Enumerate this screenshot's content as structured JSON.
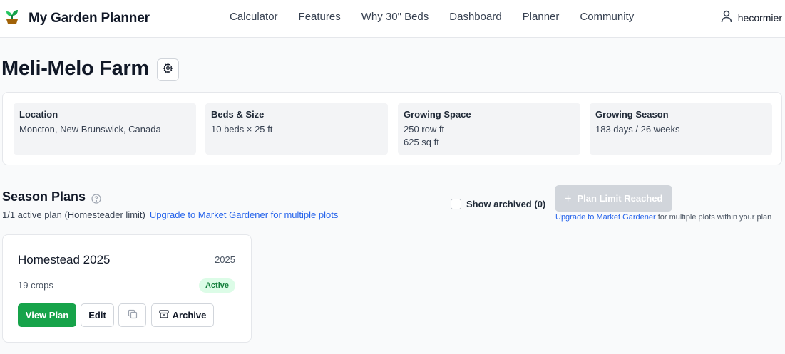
{
  "header": {
    "brand_name": "My Garden Planner",
    "nav": [
      "Calculator",
      "Features",
      "Why 30\" Beds",
      "Dashboard",
      "Planner",
      "Community"
    ],
    "username": "hecormier"
  },
  "farm": {
    "title": "Meli-Melo Farm",
    "info": [
      {
        "label": "Location",
        "values": [
          "Moncton, New Brunswick, Canada"
        ]
      },
      {
        "label": "Beds & Size",
        "values": [
          "10 beds × 25 ft"
        ]
      },
      {
        "label": "Growing Space",
        "values": [
          "250 row ft",
          "625 sq ft"
        ]
      },
      {
        "label": "Growing Season",
        "values": [
          "183 days / 26 weeks"
        ]
      }
    ]
  },
  "season": {
    "title": "Season Plans",
    "subtitle": "1/1 active plan (Homesteader limit)",
    "upgrade_link": "Upgrade to Market Gardener for multiple plots",
    "show_archived_label": "Show archived (0)",
    "limit_button": "Plan Limit Reached",
    "limit_note_link": "Upgrade to Market Gardener",
    "limit_note_rest": " for multiple plots within your plan"
  },
  "plan": {
    "name": "Homestead 2025",
    "year": "2025",
    "crops": "19 crops",
    "status": "Active",
    "view_label": "View Plan",
    "edit_label": "Edit",
    "archive_label": "Archive"
  },
  "colors": {
    "primary_green": "#16a34a",
    "link_blue": "#2563eb",
    "badge_bg": "#dcfce7",
    "disabled_gray": "#d1d5db"
  },
  "icons": [
    "sprout-icon",
    "user-icon",
    "gear-icon",
    "help-circle-icon",
    "plus-icon",
    "copy-icon",
    "archive-icon"
  ]
}
